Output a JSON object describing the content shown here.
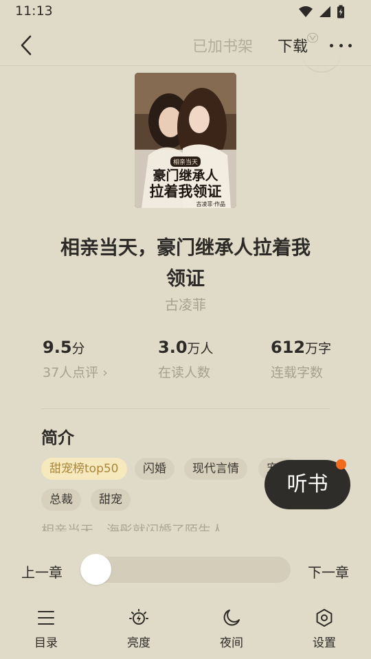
{
  "status_bar": {
    "time": "11:13",
    "icons": [
      "wifi-icon",
      "signal-icon",
      "battery-charging-icon"
    ]
  },
  "top_bar": {
    "back_icon": "chevron-left-icon",
    "shelf_label": "已加书架",
    "download_label": "下载",
    "download_badge_icon": "vip-icon",
    "more_icon": "more-dots-icon"
  },
  "book": {
    "cover": {
      "badge": "相亲当天",
      "title_line1": "豪门继承人",
      "title_line2": "拉着我领证",
      "author_credit": "古凌菲·作品"
    },
    "title": "相亲当天，豪门继承人拉着我领证",
    "author": "古凌菲"
  },
  "stats": {
    "rating": {
      "value": "9.5",
      "unit": "分",
      "label": "37人点评",
      "chevron": "›"
    },
    "readers": {
      "value": "3.0",
      "unit": "万人",
      "label": "在读人数"
    },
    "words": {
      "value": "612",
      "unit": "万字",
      "label": "连载字数"
    }
  },
  "intro": {
    "heading": "简介",
    "tags": [
      "甜宠榜top50",
      "闪婚",
      "现代言情",
      "宠妻",
      "总裁",
      "甜宠"
    ],
    "text_preview": "相亲当天，海彤就闪婚了陌生人……"
  },
  "listen_button": {
    "label": "听书",
    "has_notification": true
  },
  "chapter_nav": {
    "prev_label": "上一章",
    "next_label": "下一章",
    "progress": 0.0
  },
  "bottom_nav": [
    {
      "label": "目录",
      "icon": "list-icon"
    },
    {
      "label": "亮度",
      "icon": "brightness-icon"
    },
    {
      "label": "夜间",
      "icon": "moon-icon"
    },
    {
      "label": "设置",
      "icon": "settings-icon"
    }
  ],
  "colors": {
    "background": "#e0dbc8",
    "text_primary": "#2b2a26",
    "text_secondary": "#a6a08d",
    "accent_tag_bg": "#f6e9bd",
    "accent_tag_text": "#a9853a",
    "notification_dot": "#f26a1b",
    "listen_button_bg": "#2e2d29"
  }
}
